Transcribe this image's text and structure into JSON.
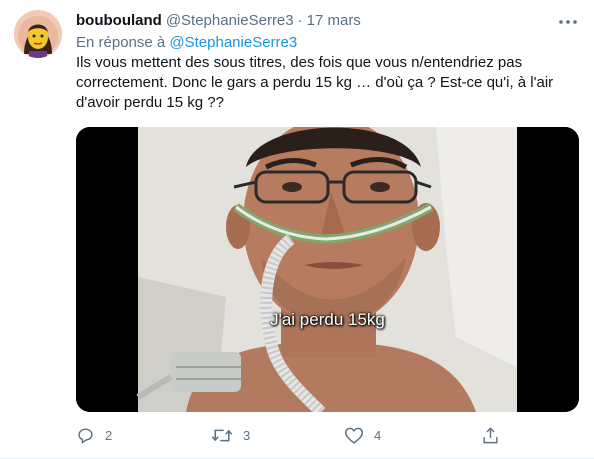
{
  "tweet": {
    "user": {
      "display_name": "boubouland",
      "handle": "@StephanieSerre3"
    },
    "separator": "·",
    "date": "17 mars",
    "reply_to": {
      "prefix": "En réponse à",
      "mention": "@StephanieSerre3"
    },
    "text": "Ils vous mettent des sous titres, des fois que vous n/entendriez pas correctement. Donc le gars a perdu 15 kg … d'où ça ? Est-ce qu'i, à l'air d'avoir perdu 15 kg ??",
    "media": {
      "subtitle": "J'ai perdu 15kg"
    },
    "actions": {
      "reply_count": "2",
      "retweet_count": "3",
      "like_count": "4"
    }
  },
  "icons": {
    "more": "more-dots-icon",
    "reply": "reply-icon",
    "retweet": "retweet-icon",
    "like": "heart-icon",
    "share": "share-icon"
  },
  "colors": {
    "text": "#0f1419",
    "secondary": "#5b7083",
    "link": "#1b95e0",
    "background": "#ffffff"
  }
}
